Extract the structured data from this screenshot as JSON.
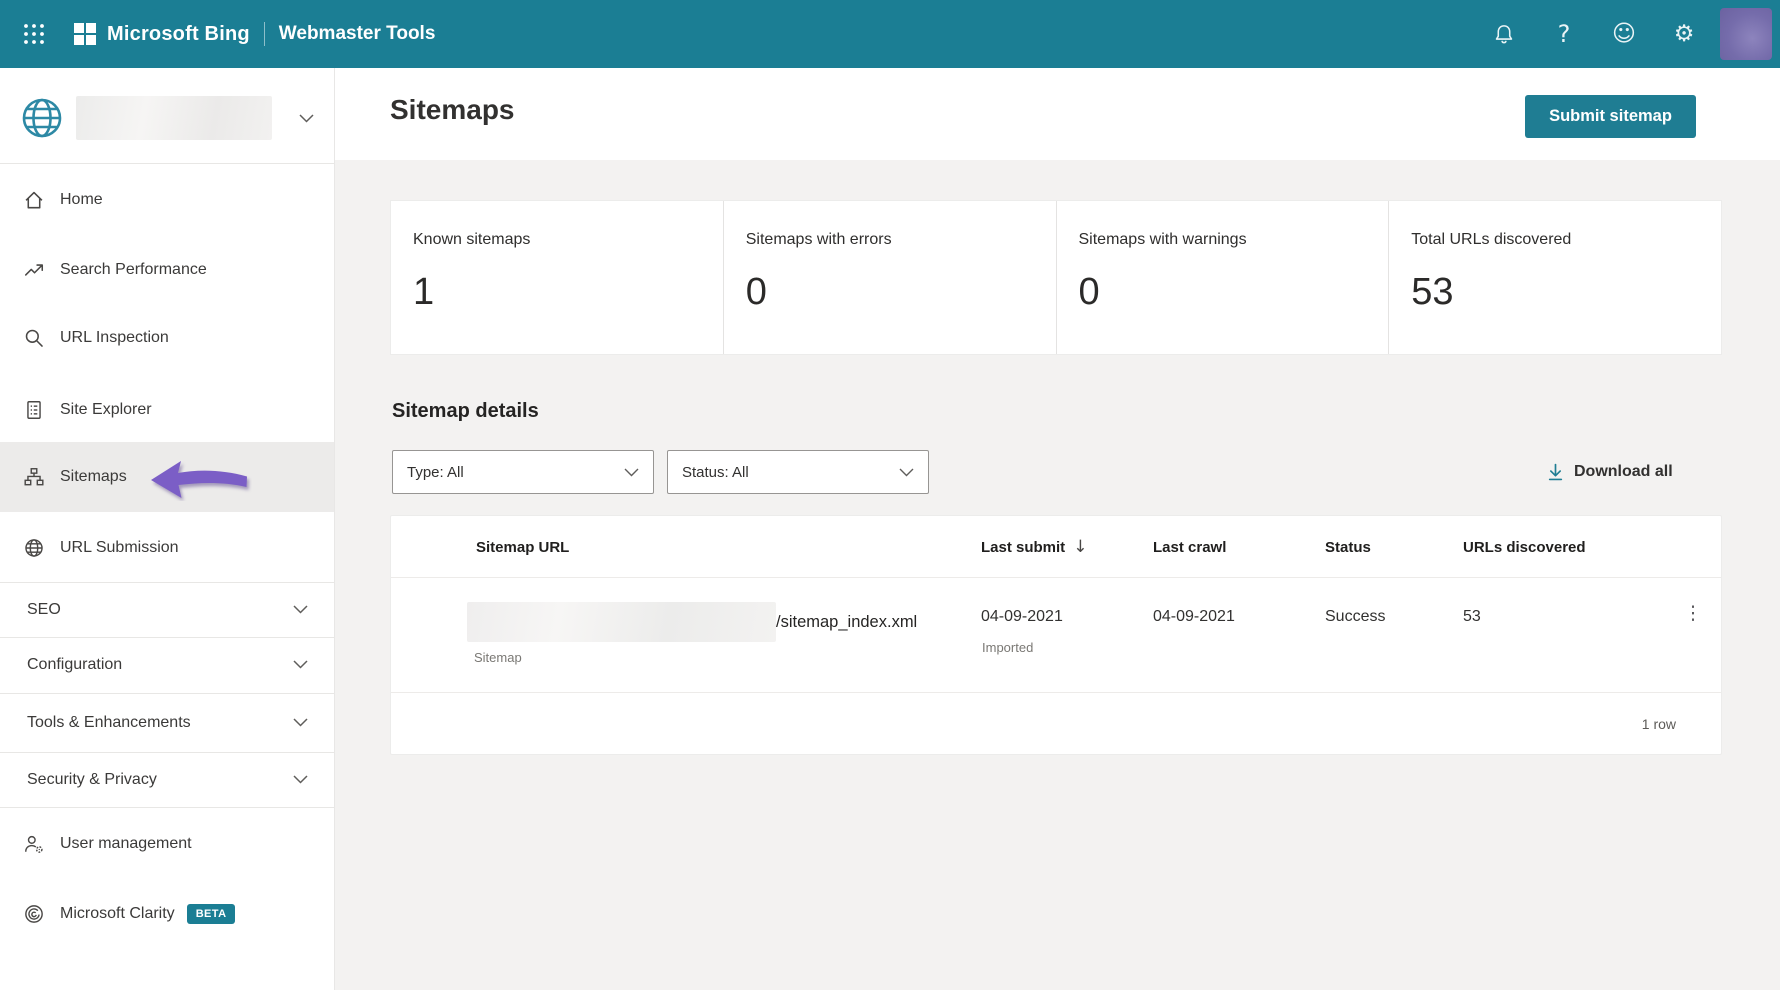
{
  "top_bar": {
    "brand": "Microsoft Bing",
    "product": "Webmaster Tools"
  },
  "icons": {
    "help_glyph": "?",
    "smiley_glyph": "☺",
    "gear_glyph": "⚙",
    "sort_descending_glyph": "↓",
    "more_options_glyph": "⋮"
  },
  "sidebar": {
    "site_selector": {
      "site_name_redacted": true
    },
    "items": [
      {
        "label": "Home",
        "icon": "home-icon"
      },
      {
        "label": "Search Performance",
        "icon": "trend-icon"
      },
      {
        "label": "URL Inspection",
        "icon": "magnifier-icon"
      },
      {
        "label": "Site Explorer",
        "icon": "document-icon"
      },
      {
        "label": "Sitemaps",
        "icon": "hierarchy-icon",
        "active": true
      },
      {
        "label": "URL Submission",
        "icon": "globe-icon"
      }
    ],
    "groups": [
      {
        "label": "SEO"
      },
      {
        "label": "Configuration"
      },
      {
        "label": "Tools & Enhancements"
      },
      {
        "label": "Security & Privacy"
      }
    ],
    "footer_items": [
      {
        "label": "User management",
        "icon": "person-gear-icon"
      },
      {
        "label": "Microsoft Clarity",
        "icon": "clarity-icon",
        "badge": "BETA"
      }
    ]
  },
  "page": {
    "title": "Sitemaps",
    "submit_button_label": "Submit sitemap"
  },
  "stats": [
    {
      "label": "Known sitemaps",
      "value": "1"
    },
    {
      "label": "Sitemaps with errors",
      "value": "0"
    },
    {
      "label": "Sitemaps with warnings",
      "value": "0"
    },
    {
      "label": "Total URLs discovered",
      "value": "53"
    }
  ],
  "sitemap_details": {
    "heading": "Sitemap details",
    "type_filter": "Type: All",
    "status_filter": "Status: All",
    "download_all_label": "Download all"
  },
  "table": {
    "columns": [
      "Sitemap URL",
      "Last submit",
      "Last crawl",
      "Status",
      "URLs discovered"
    ],
    "rows": [
      {
        "url_prefix_redacted": true,
        "url_visible_part": "/sitemap_index.xml",
        "type": "Sitemap",
        "last_submit": "04-09-2021",
        "last_submit_note": "Imported",
        "last_crawl": "04-09-2021",
        "status": "Success",
        "urls_discovered": "53"
      }
    ],
    "footer": "1 row"
  },
  "colors": {
    "top_bar_teal": "#1b7e94",
    "button_teal": "#1f7d93",
    "beta_badge_teal": "#1b7e94",
    "annotation_arrow_purple": "#7b5ec6",
    "avatar_purple": "#756cab",
    "download_icon_teal": "#1f7d93"
  }
}
